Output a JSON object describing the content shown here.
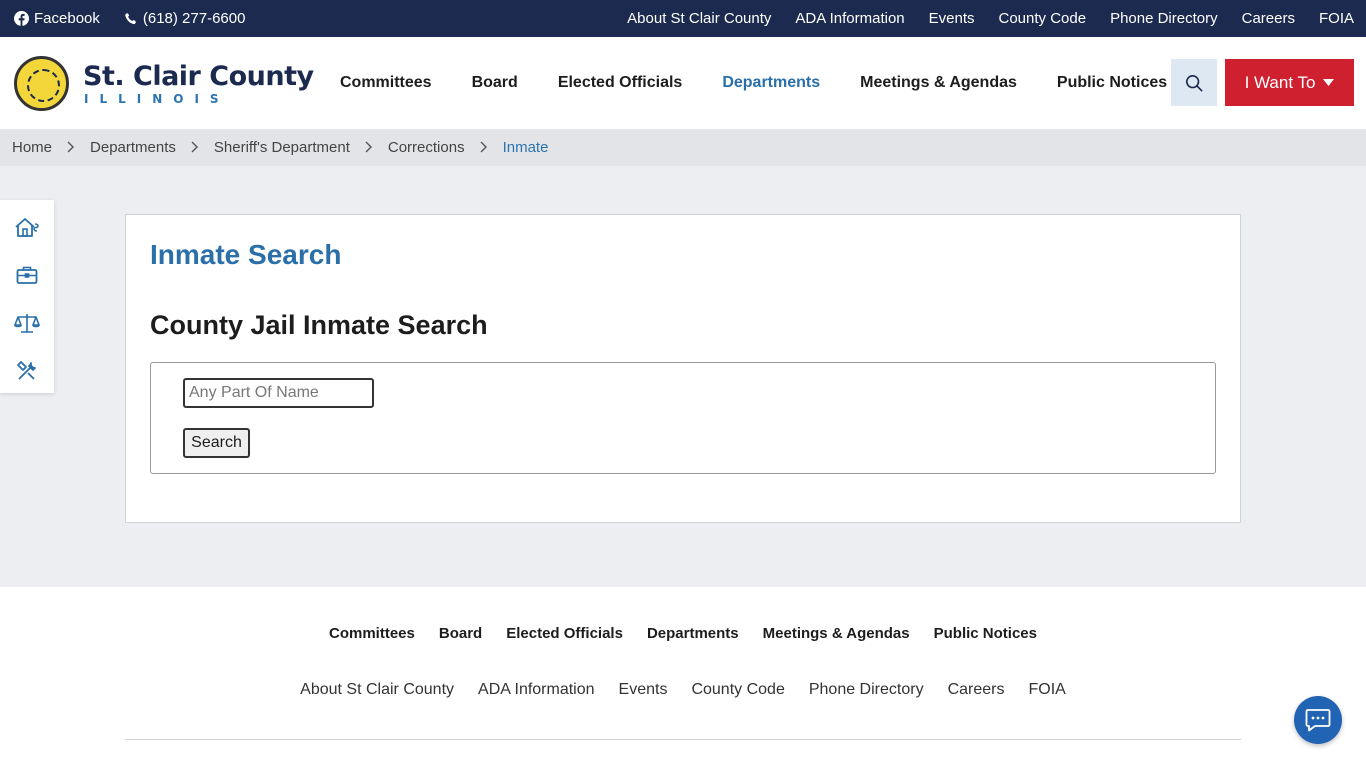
{
  "topbar": {
    "facebook_label": "Facebook",
    "phone_label": "(618) 277-6600",
    "links": [
      "About St Clair County",
      "ADA Information",
      "Events",
      "County Code",
      "Phone Directory",
      "Careers",
      "FOIA"
    ]
  },
  "header": {
    "logo_title": "St. Clair County",
    "logo_subtitle": "ILLINOIS",
    "nav": [
      "Committees",
      "Board",
      "Elected Officials",
      "Departments",
      "Meetings & Agendas",
      "Public Notices"
    ],
    "active_nav": "Departments",
    "search_icon": "search-icon",
    "i_want_to_label": "I Want To"
  },
  "breadcrumb": [
    "Home",
    "Departments",
    "Sheriff's Department",
    "Corrections",
    "Inmate"
  ],
  "sidebar": {
    "icons": [
      "house-icon",
      "briefcase-icon",
      "scales-icon",
      "tools-icon"
    ]
  },
  "main": {
    "page_title": "Inmate Search",
    "section_title": "County Jail Inmate Search",
    "name_placeholder": "Any Part Of Name",
    "search_button": "Search"
  },
  "footer": {
    "nav": [
      "Committees",
      "Board",
      "Elected Officials",
      "Departments",
      "Meetings & Agendas",
      "Public Notices"
    ],
    "links": [
      "About St Clair County",
      "ADA Information",
      "Events",
      "County Code",
      "Phone Directory",
      "Careers",
      "FOIA"
    ]
  },
  "colors": {
    "topbar_bg": "#1b2a4e",
    "accent_blue": "#2a6fa8",
    "cta_red": "#cf2030",
    "chat_blue": "#2164b3"
  }
}
